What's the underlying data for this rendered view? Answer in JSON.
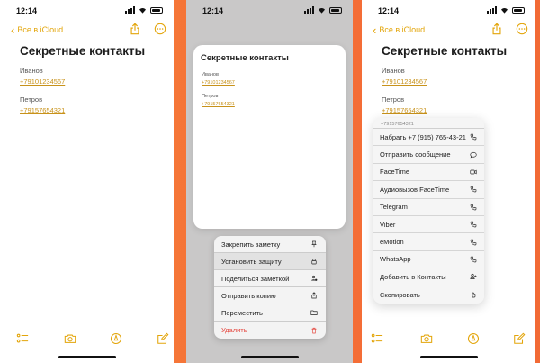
{
  "status": {
    "time": "12:14"
  },
  "nav": {
    "back_label": "Все в iCloud"
  },
  "note": {
    "title": "Секретные контакты",
    "contacts": [
      {
        "name": "Иванов",
        "phone": "+79101234567"
      },
      {
        "name": "Петров",
        "phone": "+79157654321"
      }
    ]
  },
  "panel3_phone": "+79157654321",
  "context_menu": [
    {
      "label": "Закрепить заметку",
      "icon": "pin-icon"
    },
    {
      "label": "Установить защиту",
      "icon": "lock-icon"
    },
    {
      "label": "Поделиться заметкой",
      "icon": "person-share-icon"
    },
    {
      "label": "Отправить копию",
      "icon": "share-icon"
    },
    {
      "label": "Переместить",
      "icon": "folder-icon"
    },
    {
      "label": "Удалить",
      "icon": "trash-icon"
    }
  ],
  "link_menu": {
    "header": "+79157654321",
    "items": [
      {
        "label": "Набрать +7 (915) 765-43-21",
        "icon": "phone-icon"
      },
      {
        "label": "Отправить сообщение",
        "icon": "message-icon"
      },
      {
        "label": "FaceTime",
        "icon": "video-icon"
      },
      {
        "label": "Аудиовызов FaceTime",
        "icon": "phone-icon"
      },
      {
        "label": "Telegram",
        "icon": "phone-icon"
      },
      {
        "label": "Viber",
        "icon": "phone-icon"
      },
      {
        "label": "eMotion",
        "icon": "phone-icon"
      },
      {
        "label": "WhatsApp",
        "icon": "phone-icon"
      },
      {
        "label": "Добавить в Контакты",
        "icon": "add-contact-icon"
      },
      {
        "label": "Скопировать",
        "icon": "copy-icon"
      }
    ]
  },
  "colors": {
    "accent": "#e3a50a",
    "link": "#c8921a",
    "danger": "#e5453d",
    "background": "#f56f36"
  }
}
